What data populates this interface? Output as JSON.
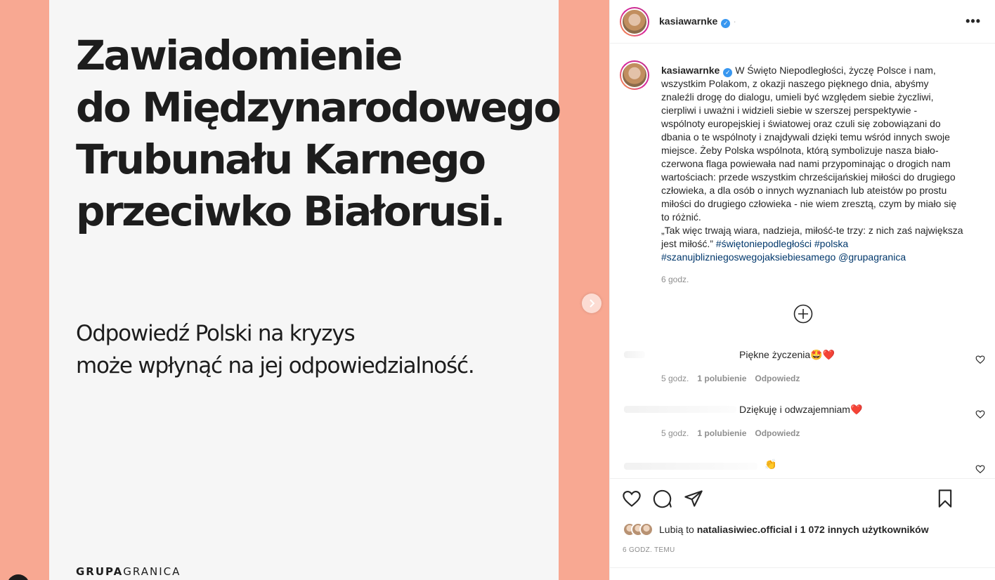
{
  "slide": {
    "title_lines": [
      "Zawiadomienie",
      "do Międzynarodowego",
      "Trubunału Karnego",
      "przeciwko Białorusi."
    ],
    "subtitle_lines": [
      "Odpowiedź Polski na kryzys",
      "może wpłynąć na jej odpowiedzialność."
    ],
    "brand_bold": "GRUPA",
    "brand_light": "GRANICA"
  },
  "colors": {
    "media_bg": "#f8a892",
    "slide_bg": "#f6f6f6",
    "link": "#00376b",
    "verified": "#3897f0",
    "heart": "#ed4956"
  },
  "header": {
    "username": "kasiawarnke",
    "dot": "·",
    "more_label": "•••"
  },
  "caption": {
    "username": "kasiawarnke",
    "text_lines": [
      "W Święto Niepodległości, życzę Polsce i nam,",
      "wszystkim Polakom, z okazji naszego pięknego dnia, abyśmy",
      "znaleźli drogę do dialogu, umieli być względem siebie życzliwi,",
      "cierpliwi i uważni i widzieli siebie w szerszej perspektywie -",
      "wspólnoty europejskiej i światowej oraz czuli się zobowiązani do",
      "dbania o te wspólnoty i znajdywali dzięki temu wśród innych swoje",
      "miejsce. Żeby Polska wspólnota, którą symbolizuje nasza biało-",
      "czerwona flaga powiewała nad nami przypominając o drogich nam",
      "wartościach: przede wszystkim chrześcijańskiej miłości do drugiego",
      "człowieka, a dla osób o innych wyznaniach lub ateistów po prostu",
      "miłości do drugiego człowieka - nie wiem zresztą, czym by miało się",
      "to różnić.",
      "„Tak więc trwają wiara, nadzieja, miłość-te trzy: z nich zaś największa"
    ],
    "last_line_text": "jest miłość.”",
    "hashtag1": "#świętoniepodległości",
    "hashtag2": "#polska",
    "hashtag3": "#szanujblizniegoswegojaksiebiesamego",
    "mention": "@grupagranica",
    "time": "6 godz."
  },
  "comments": [
    {
      "text": "Piękne życzenia🤩❤️",
      "time": "5 godz.",
      "likes": "1 polubienie",
      "reply": "Odpowiedz"
    },
    {
      "text": "Dziękuję i odwzajemniam❤️",
      "time": "5 godz.",
      "likes": "1 polubienie",
      "reply": "Odpowiedz"
    },
    {
      "text": "👏"
    }
  ],
  "actions": {
    "likes_prefix": "Lubią to",
    "likes_user": "nataliasiwiec.official",
    "likes_suffix": "i 1 072 innych użytkowników",
    "time_ago": "6 GODZ. TEMU"
  }
}
